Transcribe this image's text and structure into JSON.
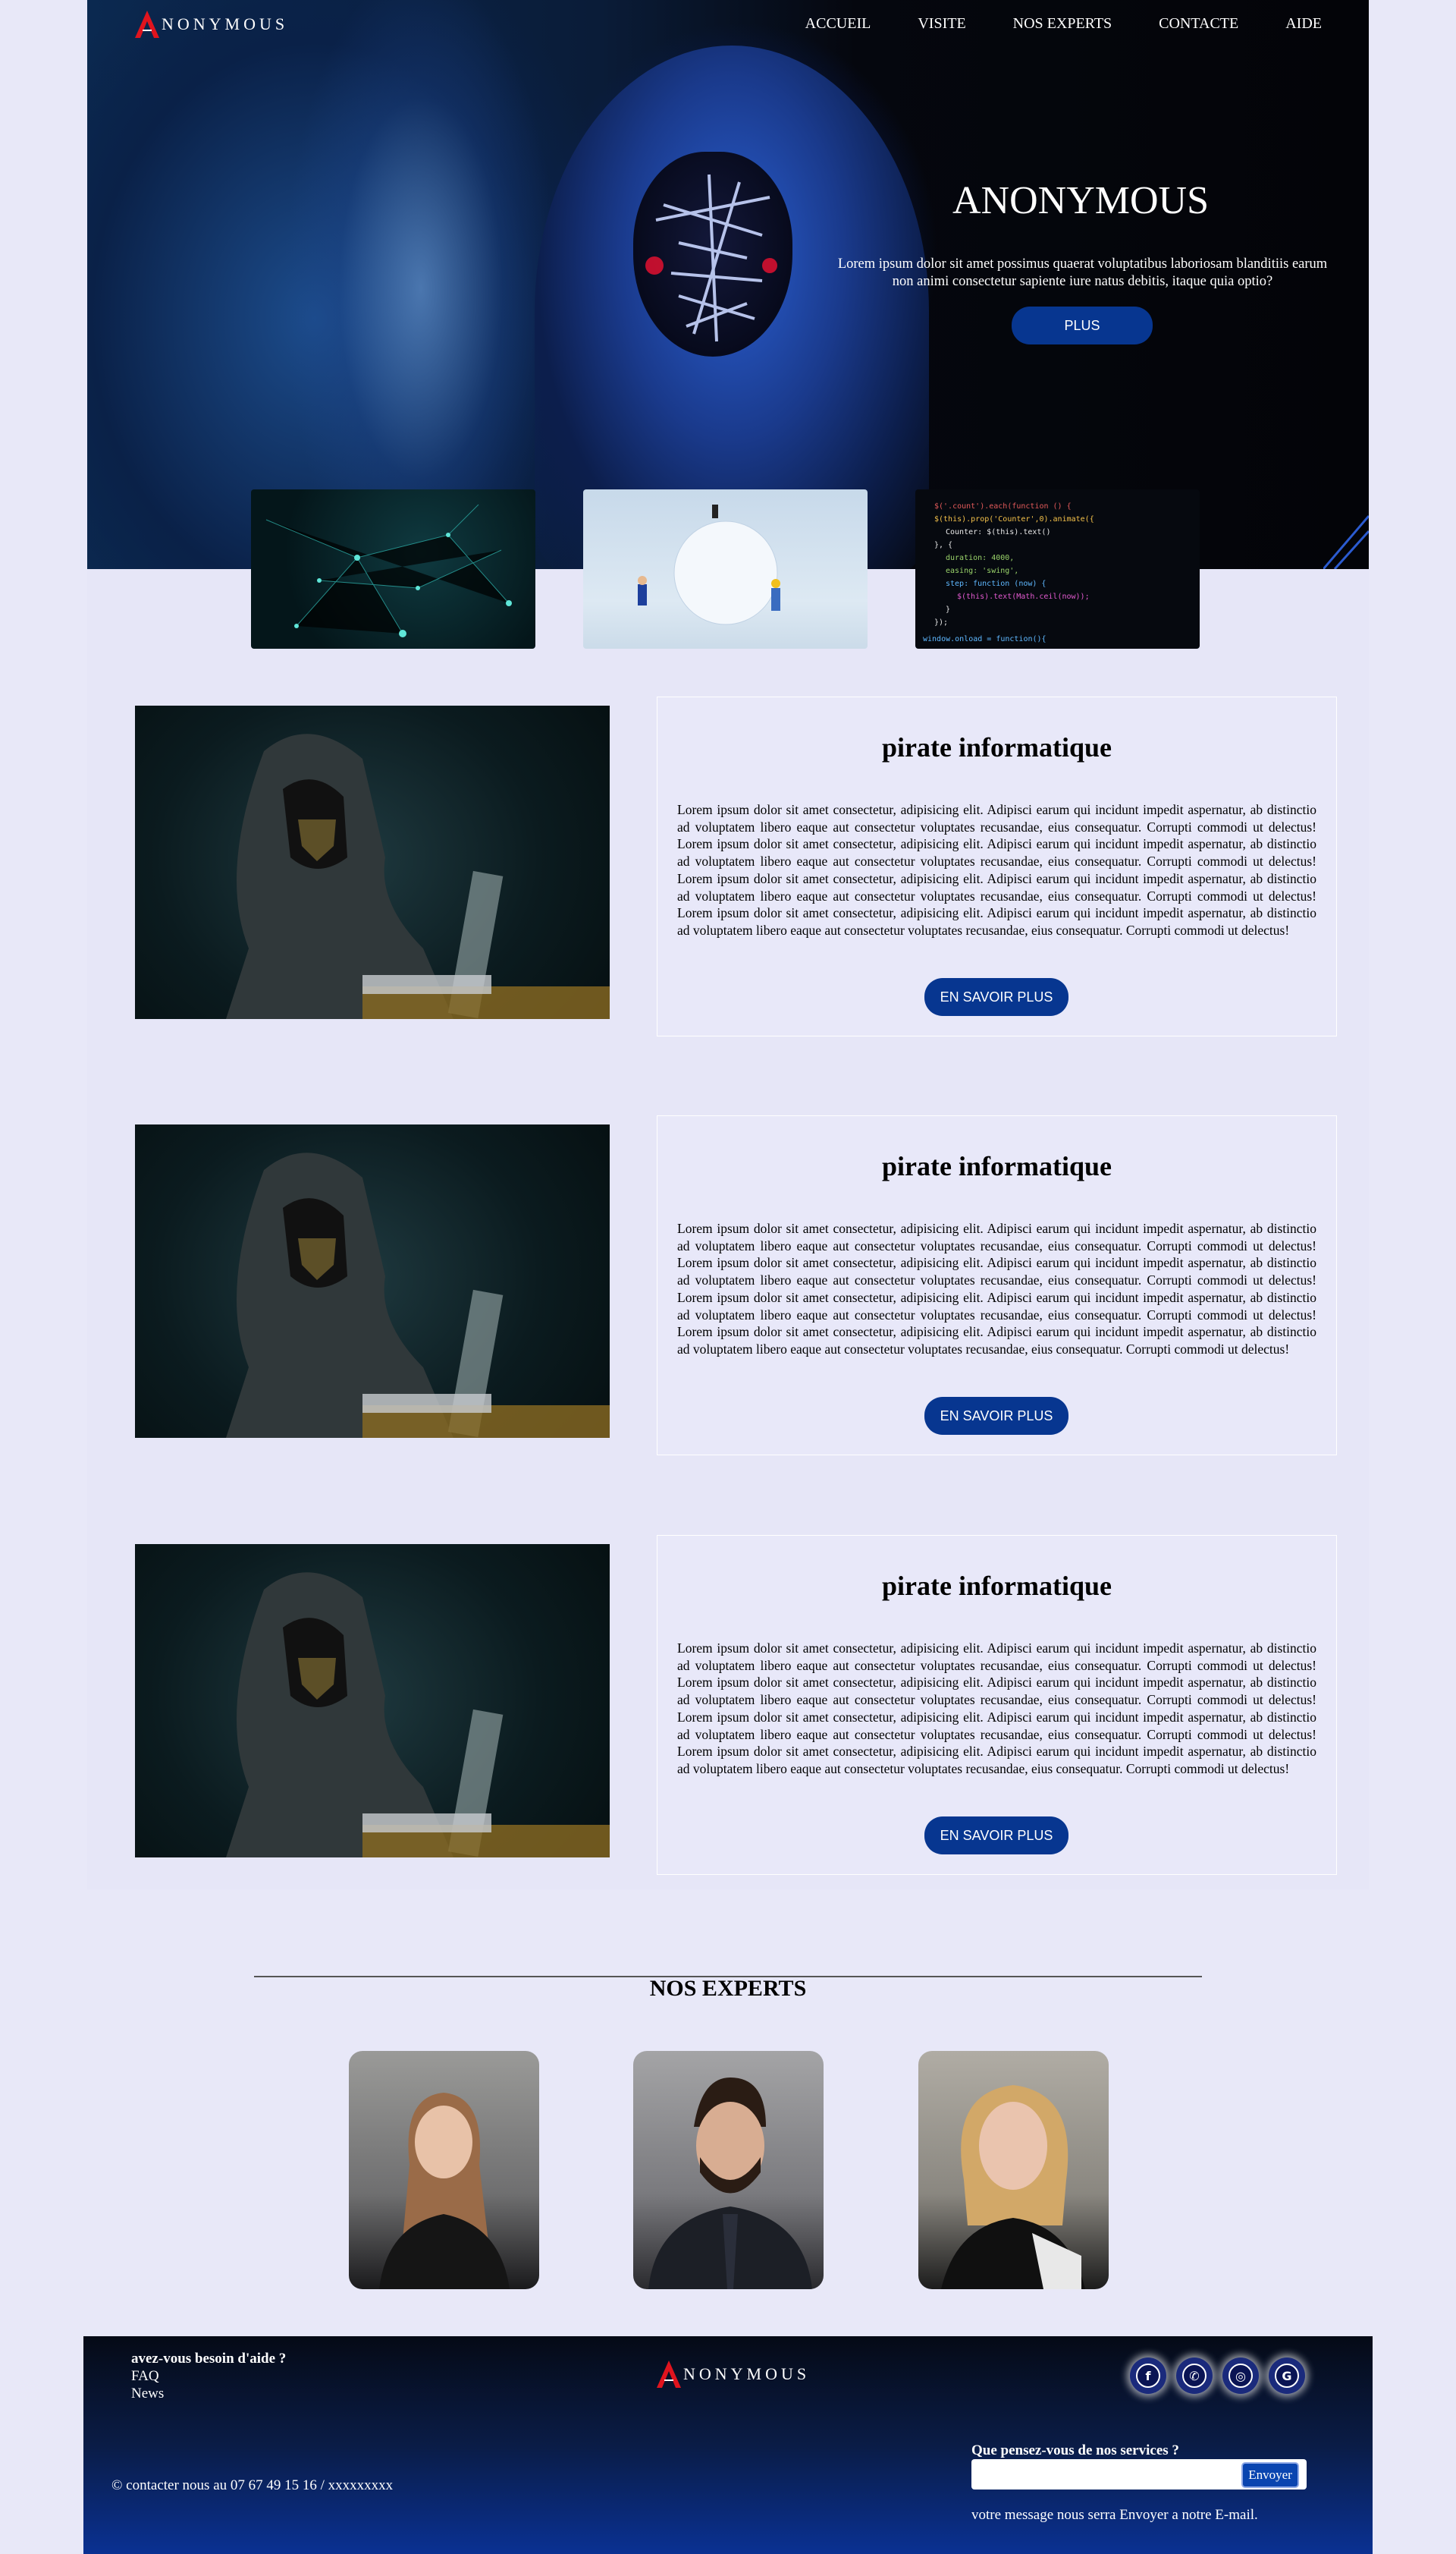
{
  "brand": {
    "logo_letter": "A",
    "logo_text": "NONYMOUS"
  },
  "nav": {
    "items": [
      "ACCUEIL",
      "VISITE",
      "NOS EXPERTS",
      "CONTACTE",
      "AIDE"
    ]
  },
  "hero": {
    "title": "ANONYMOUS",
    "text": "Lorem ipsum dolor sit amet possimus quaerat voluptatibus laboriosam blanditiis earum non animi consectetur sapiente iure natus debitis, itaque quia optio?",
    "button": "PLUS"
  },
  "articles": [
    {
      "title": "pirate informatique",
      "body": "Lorem ipsum dolor sit amet consectetur, adipisicing elit. Adipisci earum qui incidunt impedit aspernatur, ab distinctio ad voluptatem libero eaque aut consectetur voluptates recusandae, eius consequatur. Corrupti commodi ut delectus! Lorem ipsum dolor sit amet consectetur, adipisicing elit. Adipisci earum qui incidunt impedit aspernatur, ab distinctio ad voluptatem libero eaque aut consectetur voluptates recusandae, eius consequatur. Corrupti commodi ut delectus! Lorem ipsum dolor sit amet consectetur, adipisicing elit. Adipisci earum qui incidunt impedit aspernatur, ab distinctio ad voluptatem libero eaque aut consectetur voluptates recusandae, eius consequatur. Corrupti commodi ut delectus! Lorem ipsum dolor sit amet consectetur, adipisicing elit. Adipisci earum qui incidunt impedit aspernatur, ab distinctio ad voluptatem libero eaque aut consectetur voluptates recusandae, eius consequatur. Corrupti commodi ut delectus!",
      "button": "EN SAVOIR PLUS"
    },
    {
      "title": "pirate informatique",
      "body": "Lorem ipsum dolor sit amet consectetur, adipisicing elit. Adipisci earum qui incidunt impedit aspernatur, ab distinctio ad voluptatem libero eaque aut consectetur voluptates recusandae, eius consequatur. Corrupti commodi ut delectus! Lorem ipsum dolor sit amet consectetur, adipisicing elit. Adipisci earum qui incidunt impedit aspernatur, ab distinctio ad voluptatem libero eaque aut consectetur voluptates recusandae, eius consequatur. Corrupti commodi ut delectus! Lorem ipsum dolor sit amet consectetur, adipisicing elit. Adipisci earum qui incidunt impedit aspernatur, ab distinctio ad voluptatem libero eaque aut consectetur voluptates recusandae, eius consequatur. Corrupti commodi ut delectus! Lorem ipsum dolor sit amet consectetur, adipisicing elit. Adipisci earum qui incidunt impedit aspernatur, ab distinctio ad voluptatem libero eaque aut consectetur voluptates recusandae, eius consequatur. Corrupti commodi ut delectus!",
      "button": "EN SAVOIR PLUS"
    },
    {
      "title": "pirate informatique",
      "body": "Lorem ipsum dolor sit amet consectetur, adipisicing elit. Adipisci earum qui incidunt impedit aspernatur, ab distinctio ad voluptatem libero eaque aut consectetur voluptates recusandae, eius consequatur. Corrupti commodi ut delectus! Lorem ipsum dolor sit amet consectetur, adipisicing elit. Adipisci earum qui incidunt impedit aspernatur, ab distinctio ad voluptatem libero eaque aut consectetur voluptates recusandae, eius consequatur. Corrupti commodi ut delectus! Lorem ipsum dolor sit amet consectetur, adipisicing elit. Adipisci earum qui incidunt impedit aspernatur, ab distinctio ad voluptatem libero eaque aut consectetur voluptates recusandae, eius consequatur. Corrupti commodi ut delectus! Lorem ipsum dolor sit amet consectetur, adipisicing elit. Adipisci earum qui incidunt impedit aspernatur, ab distinctio ad voluptatem libero eaque aut consectetur voluptates recusandae, eius consequatur. Corrupti commodi ut delectus!",
      "button": "EN SAVOIR PLUS"
    }
  ],
  "experts": {
    "title": "NOS EXPERTS"
  },
  "footer": {
    "help_question": "avez-vous besoin d'aide ?",
    "links": [
      "FAQ",
      "News"
    ],
    "contact": "© contacter nous au 07 67 49 15 16 / xxxxxxxxx",
    "survey_question": "Que pensez-vous de nos services ?",
    "send_button": "Envoyer",
    "note": "votre message nous serra Envoyer a notre E-mail.",
    "social_icons": [
      "facebook-icon",
      "whatsapp-icon",
      "instagram-icon",
      "google-icon"
    ]
  },
  "colors": {
    "accent": "#073690",
    "background": "#e6e6f7",
    "footer_bottom": "#0a3193"
  }
}
